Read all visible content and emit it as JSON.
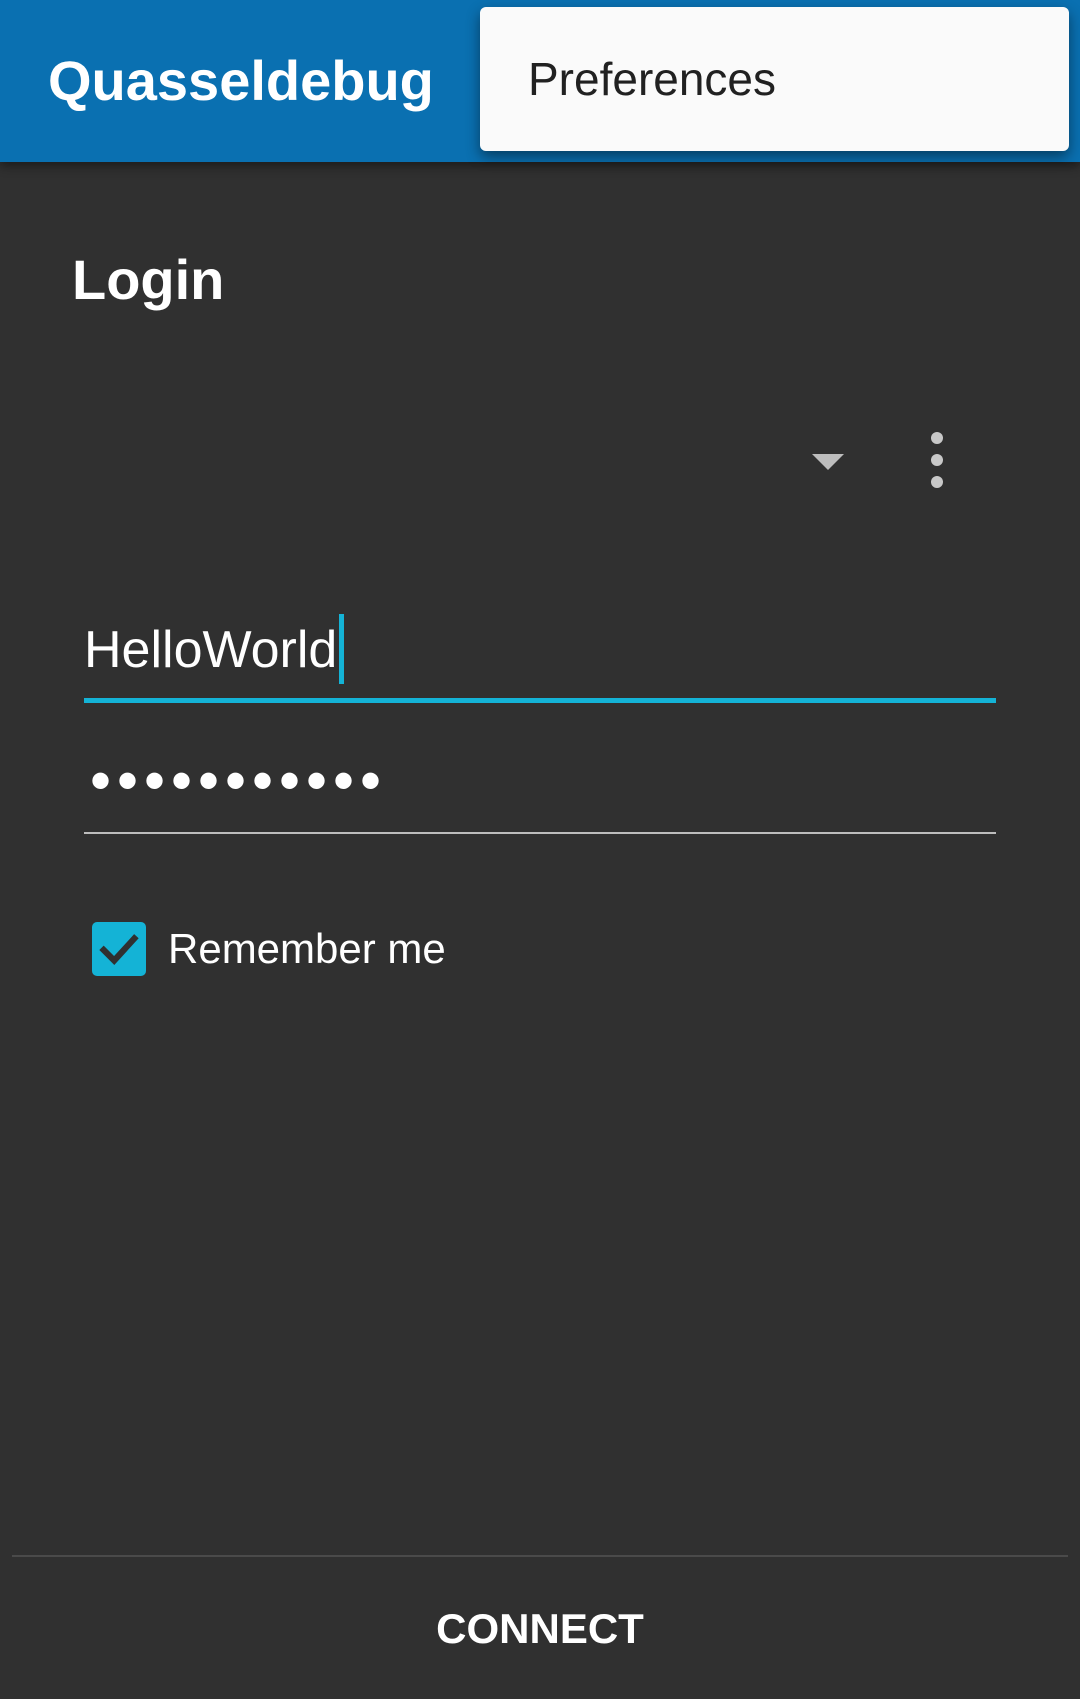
{
  "app_bar": {
    "title": "Quasseldebug",
    "background_color": "#0a70b1"
  },
  "overflow_menu": {
    "items": [
      {
        "label": "Preferences"
      }
    ]
  },
  "login": {
    "section_title": "Login",
    "account_spinner": {
      "selected_value": "",
      "icon": "arrow-drop-down-icon"
    },
    "more_options_icon": "more-vert-icon",
    "username": {
      "value": "HelloWorld",
      "focused": true
    },
    "password": {
      "masked_value": "•••••••••••"
    },
    "remember_me": {
      "label": "Remember me",
      "checked": true
    },
    "connect_label": "CONNECT"
  },
  "colors": {
    "accent": "#14b3d6",
    "background": "#303030",
    "menu_background": "#fafafa"
  }
}
